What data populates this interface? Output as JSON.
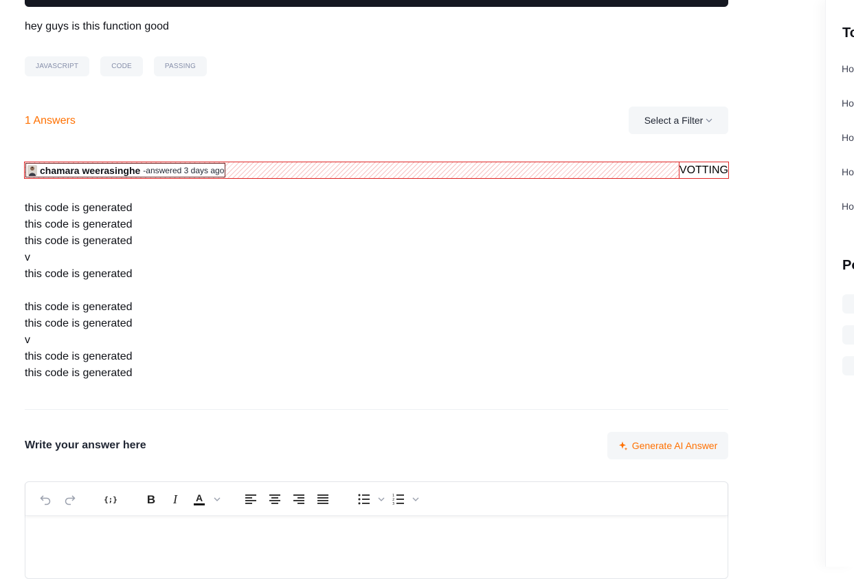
{
  "question": {
    "text": "hey guys is this function good",
    "tags": [
      "JAVASCRIPT",
      "CODE",
      "PASSING"
    ]
  },
  "answers": {
    "count_label": "1 Answers",
    "filter_label": "Select a Filter"
  },
  "answer": {
    "author": "chamara weerasinghe",
    "meta": "-answered 3 days ago",
    "votting_label": "VOTTING",
    "lines": [
      "this code is generated",
      "this code is generated",
      "this code is generated",
      "v",
      "this code is generated",
      "",
      "this code is generated",
      "this code is generated",
      "v",
      "this code is generated",
      "this code is generated"
    ]
  },
  "editor": {
    "label": "Write your answer here",
    "ai_button": "Generate AI Answer"
  },
  "sidebar": {
    "top_title": "To",
    "items": [
      "Ho",
      "Ho",
      "Ho",
      "Ho",
      "Ho"
    ],
    "popular_title": "Po"
  },
  "colors": {
    "accent": "#ff7000",
    "tag_text": "#858ea9",
    "highlight_red": "#e02424"
  }
}
